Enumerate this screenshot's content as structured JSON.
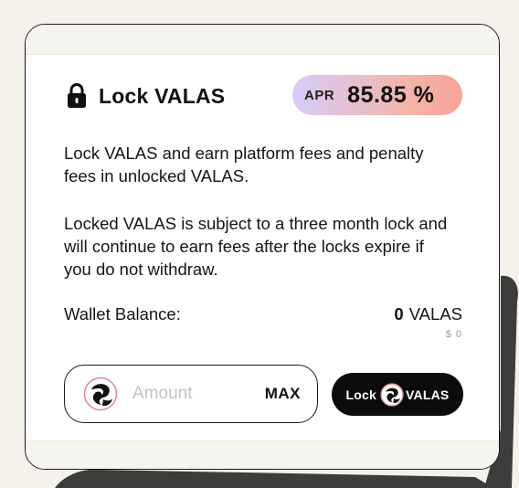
{
  "card": {
    "title": "Lock VALAS",
    "title_icon": "lock-icon",
    "apr": {
      "label": "APR",
      "value": "85.85 %"
    },
    "description_1": "Lock VALAS and earn platform fees and penalty fees in unlocked VALAS.",
    "description_2": "Locked VALAS is subject to a three month lock and will continue to earn fees after the locks expire if you do not withdraw.",
    "wallet": {
      "label": "Wallet Balance:",
      "amount": "0",
      "token": "VALAS",
      "usd_value": "$ 0"
    },
    "input": {
      "placeholder": "Amount",
      "value": "",
      "max_label": "MAX",
      "token_icon": "valas-token-icon"
    },
    "lock_button": {
      "prefix": "Lock",
      "suffix": "VALAS",
      "icon": "valas-token-icon"
    }
  },
  "colors": {
    "background": "#f4f1ea",
    "card_border": "#1a1a1a",
    "apr_gradient_start": "#d6ccf7",
    "apr_gradient_end": "#f7a39a",
    "button_bg": "#0c0c0c",
    "placeholder": "#c2c2c2"
  }
}
